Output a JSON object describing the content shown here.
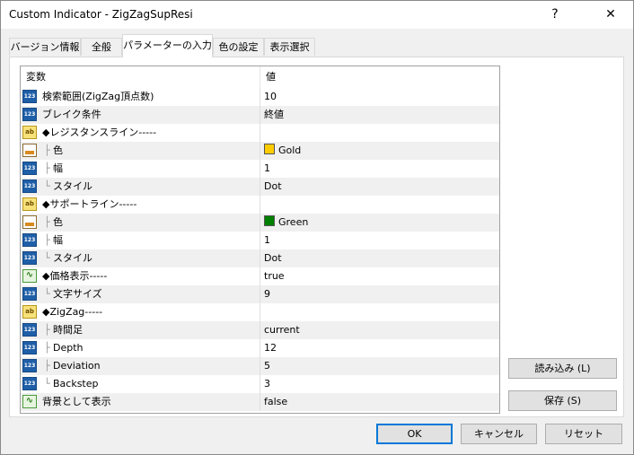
{
  "window": {
    "title": "Custom Indicator - ZigZagSupResi",
    "help_glyph": "?",
    "close_glyph": "✕"
  },
  "tabs": [
    {
      "label": "バージョン情報"
    },
    {
      "label": "全般"
    },
    {
      "label": "パラメーターの入力"
    },
    {
      "label": "色の設定"
    },
    {
      "label": "表示選択"
    }
  ],
  "grid": {
    "headers": {
      "name": "変数",
      "value": "値"
    },
    "rows": [
      {
        "icon": "123",
        "tree": "",
        "name": "検索範囲(ZigZag頂点数)",
        "value": "10"
      },
      {
        "icon": "123",
        "tree": "",
        "name": "ブレイク条件",
        "value": "終値"
      },
      {
        "icon": "ab",
        "tree": "",
        "name": "◆レジスタンスライン-----",
        "value": ""
      },
      {
        "icon": "color",
        "tree": "├",
        "name": "色",
        "value": "Gold",
        "swatch": "#ffcc00"
      },
      {
        "icon": "123",
        "tree": "├",
        "name": "幅",
        "value": "1"
      },
      {
        "icon": "123",
        "tree": "└",
        "name": "スタイル",
        "value": "Dot"
      },
      {
        "icon": "ab",
        "tree": "",
        "name": "◆サポートライン-----",
        "value": ""
      },
      {
        "icon": "color",
        "tree": "├",
        "name": "色",
        "value": "Green",
        "swatch": "#008000"
      },
      {
        "icon": "123",
        "tree": "├",
        "name": "幅",
        "value": "1"
      },
      {
        "icon": "123",
        "tree": "└",
        "name": "スタイル",
        "value": "Dot"
      },
      {
        "icon": "bool",
        "tree": "",
        "name": "◆価格表示-----",
        "value": "true"
      },
      {
        "icon": "123",
        "tree": "└",
        "name": "文字サイズ",
        "value": "9"
      },
      {
        "icon": "ab",
        "tree": "",
        "name": "◆ZigZag-----",
        "value": ""
      },
      {
        "icon": "123",
        "tree": "├",
        "name": "時間足",
        "value": "current"
      },
      {
        "icon": "123",
        "tree": "├",
        "name": "Depth",
        "value": "12"
      },
      {
        "icon": "123",
        "tree": "├",
        "name": "Deviation",
        "value": "5"
      },
      {
        "icon": "123",
        "tree": "└",
        "name": "Backstep",
        "value": "3"
      },
      {
        "icon": "bool",
        "tree": "",
        "name": "背景として表示",
        "value": "false"
      }
    ]
  },
  "side_buttons": {
    "load": "読み込み (L)",
    "save": "保存 (S)"
  },
  "footer_buttons": {
    "ok": "OK",
    "cancel": "キャンセル",
    "reset": "リセット"
  }
}
